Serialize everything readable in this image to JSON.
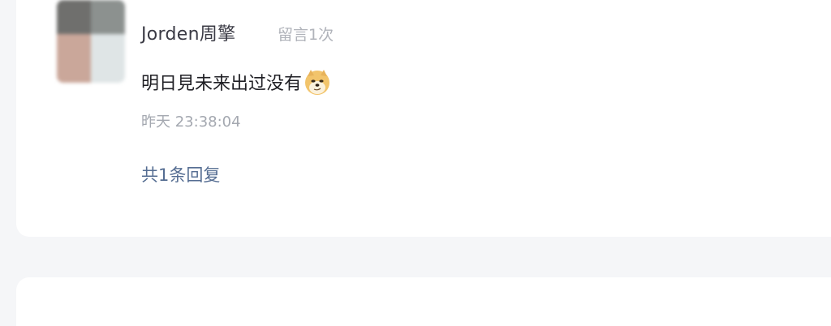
{
  "comment": {
    "username": "Jorden周擎",
    "meta": "留言1次",
    "text": "明日見未来出过没有",
    "emoji_icon": "doge-icon",
    "time": "昨天 23:38:04",
    "replies_label": "共1条回复"
  },
  "colors": {
    "background": "#f5f6f8",
    "card": "#ffffff",
    "reply_link": "#556d92",
    "muted": "#a4a8b0"
  }
}
